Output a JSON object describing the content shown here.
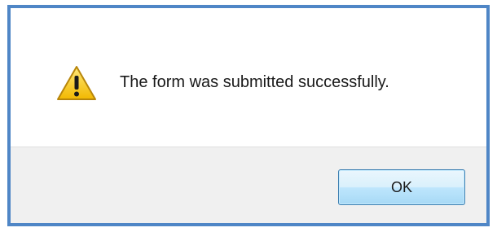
{
  "dialog": {
    "message": "The form was submitted successfully.",
    "icon": "warning-icon",
    "ok_label": "OK"
  },
  "colors": {
    "border": "#4f86c6",
    "button_area": "#f0f0f0",
    "warning_fill": "#f5c400"
  }
}
